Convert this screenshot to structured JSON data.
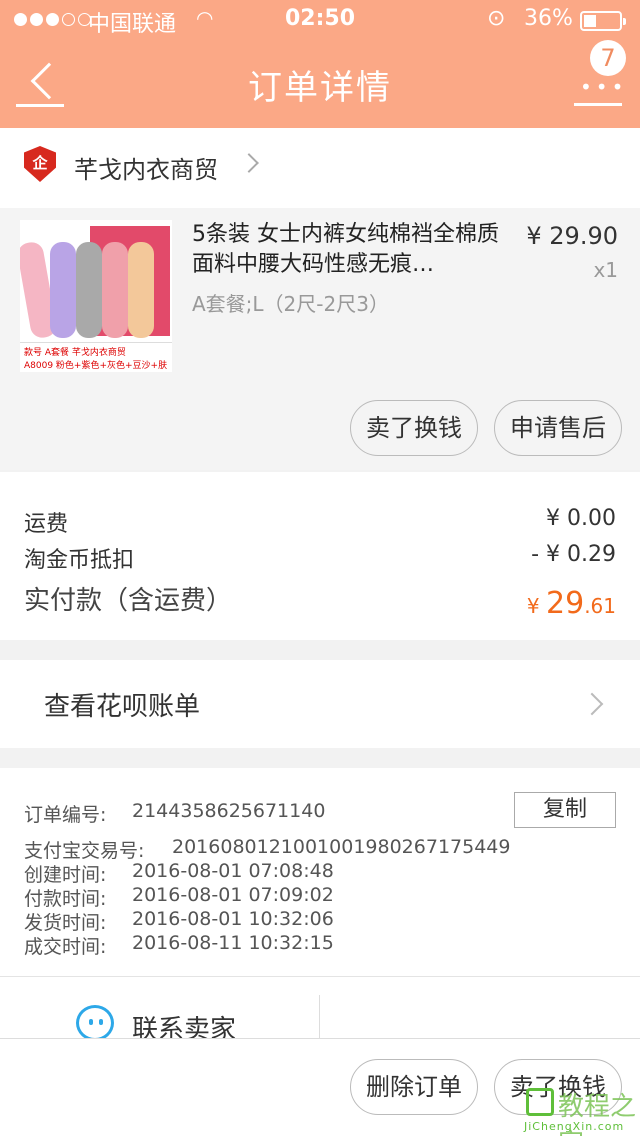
{
  "status_bar": {
    "carrier": "中国联通",
    "time": "02:50",
    "battery": "36%"
  },
  "header": {
    "title": "订单详情",
    "badge_count": "7"
  },
  "shop": {
    "name": "芊戈内衣商贸",
    "icon_text": "企"
  },
  "product": {
    "title": "5条装 女士内裤女纯棉裆全棉质面料中腰大码性感无痕…",
    "spec": "A套餐;L（2尺-2尺3）",
    "price": "¥ 29.90",
    "quantity": "x1",
    "thumb_label_1": "款号 A套餐  芊戈内衣商贸",
    "thumb_label_2": "A8009 粉色+紫色+灰色+豆沙+肤色",
    "actions": [
      "卖了换钱",
      "申请售后"
    ]
  },
  "fees": {
    "shipping_label": "运费",
    "shipping_value": "¥ 0.00",
    "coin_label": "淘金币抵扣",
    "coin_value": "- ¥ 0.29",
    "total_label": "实付款（含运费）",
    "total_currency": "¥ ",
    "total_int": "29",
    "total_dec": ".61"
  },
  "huabei": {
    "label": "查看花呗账单"
  },
  "order_info": {
    "order_no_label": "订单编号:",
    "order_no": "2144358625671140",
    "copy_label": "复制",
    "alipay_label": "支付宝交易号:",
    "alipay_no": "2016080121001001980267175449",
    "created_label": "创建时间:",
    "created": "2016-08-01 07:08:48",
    "paid_label": "付款时间:",
    "paid": "2016-08-01 07:09:02",
    "shipped_label": "发货时间:",
    "shipped": "2016-08-01 10:32:06",
    "completed_label": "成交时间:",
    "completed": "2016-08-11 10:32:15"
  },
  "contact": {
    "label": "联系卖家"
  },
  "bottom_bar": {
    "delete_label": "删除订单",
    "sell_label": "卖了换钱"
  },
  "watermark": {
    "text": "教程之家",
    "sub": "JiChengXin.com"
  },
  "colors": {
    "header_bg": "#fba886",
    "price_accent": "#f26a1b",
    "shop_icon": "#d7291e",
    "contact_icon": "#2da8e8"
  }
}
